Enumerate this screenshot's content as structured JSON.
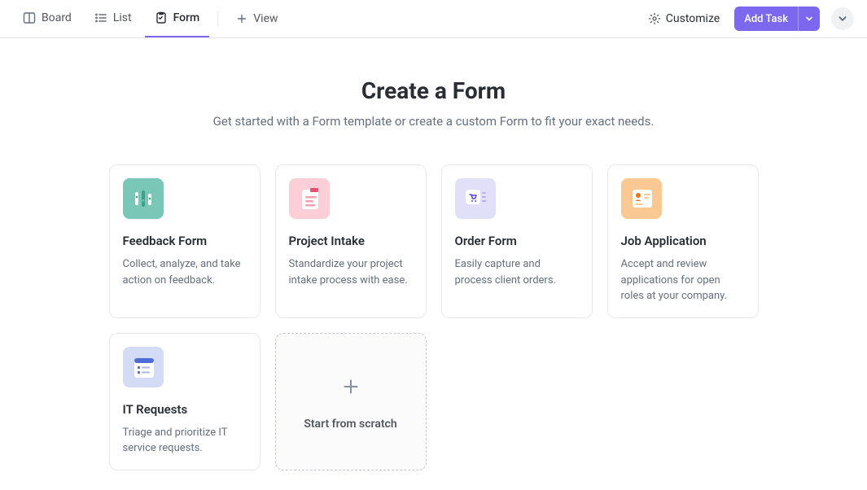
{
  "tabs": {
    "board": "Board",
    "list": "List",
    "form": "Form",
    "add_view": "View"
  },
  "toolbar": {
    "customize": "Customize",
    "add_task": "Add Task"
  },
  "header": {
    "title": "Create a Form",
    "subtitle": "Get started with a Form template or create a custom Form to fit your exact needs."
  },
  "templates": [
    {
      "title": "Feedback Form",
      "desc": "Collect, analyze, and take action on feedback."
    },
    {
      "title": "Project Intake",
      "desc": "Standardize your project intake process with ease."
    },
    {
      "title": "Order Form",
      "desc": "Easily capture and process client orders."
    },
    {
      "title": "Job Application",
      "desc": "Accept and review applications for open roles at your company."
    },
    {
      "title": "IT Requests",
      "desc": "Triage and prioritize IT service requests."
    }
  ],
  "scratch": {
    "label": "Start from scratch"
  }
}
